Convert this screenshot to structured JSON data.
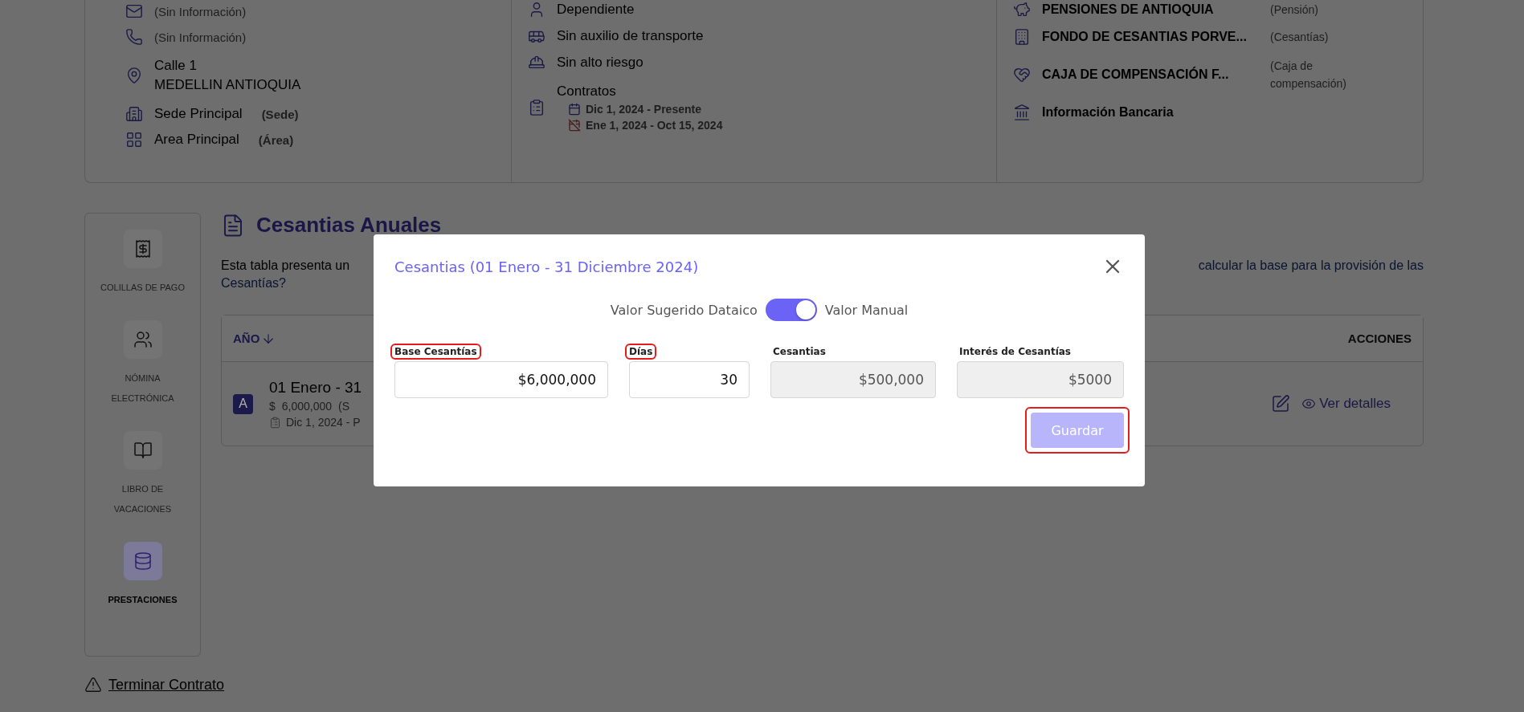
{
  "info_card": {
    "personal": [
      {
        "kind": "missing",
        "text": "(Sin Información)"
      },
      {
        "kind": "missing",
        "text": "(Sin Información)"
      },
      {
        "kind": "address",
        "lines": [
          "Calle 1",
          "MEDELLIN ANTIOQUIA"
        ]
      },
      {
        "kind": "value",
        "text": "Sede Principal",
        "note": "(Sede)"
      },
      {
        "kind": "value",
        "text": "Area Principal",
        "note": "(Área)"
      }
    ],
    "employment": [
      {
        "kind": "value",
        "text": "Dependiente"
      },
      {
        "kind": "value",
        "text": "Sin auxilio de transporte"
      },
      {
        "kind": "value",
        "text": "Sin alto riesgo"
      },
      {
        "kind": "contracts",
        "text": "Contratos",
        "contracts": [
          {
            "period": "Dic 1, 2024 - Presente",
            "active": true
          },
          {
            "period": "Ene 1, 2024 - Oct 15, 2024",
            "active": false
          }
        ]
      }
    ],
    "entities": [
      {
        "name": "PENSIONES DE ANTIOQUIA",
        "role": "(Pensión)"
      },
      {
        "name": "FONDO DE CESANTIAS PORVE...",
        "role": "(Cesantías)"
      },
      {
        "name": "CAJA DE COMPENSACIÓN F...",
        "role": "(Caja de compensación)"
      },
      {
        "name": "Información Bancaria"
      }
    ]
  },
  "sidebar": {
    "items": [
      {
        "label": "COLILLAS DE PAGO",
        "selected": false
      },
      {
        "label": "NÓMINA ELECTRÓNICA",
        "selected": false
      },
      {
        "label": "LIBRO DE VACACIONES",
        "selected": false
      },
      {
        "label": "PRESTACIONES",
        "selected": true
      }
    ]
  },
  "section": {
    "title": "Cesantias Anuales",
    "description_start": "Esta tabla presenta un",
    "description_link": "calcular la base para la provisión de las",
    "description_link_end": "Cesantías?",
    "table": {
      "columns": [
        "AÑO",
        "ACCIONES"
      ],
      "rows": [
        {
          "badge": "A",
          "period": "01 Enero - 31",
          "currency": "$",
          "amount": "6,000,000",
          "amount_note": "(S",
          "contract": "Dic 1, 2024 - P",
          "action": "Ver detalles"
        }
      ]
    }
  },
  "footer": {
    "link": "Terminar Contrato"
  },
  "modal": {
    "title": "Cesantias (01 Enero - 31 Diciembre 2024)",
    "toggle": {
      "left_label": "Valor Sugerido Dataico",
      "right_label": "Valor Manual",
      "on": true
    },
    "fields": [
      {
        "label": "Base Cesantías",
        "value": "$6,000,000",
        "disabled": false,
        "highlighted": true
      },
      {
        "label": "Días",
        "value": "30",
        "disabled": false,
        "highlighted": true
      },
      {
        "label": "Cesantias",
        "value": "$500,000",
        "disabled": true,
        "highlighted": false
      },
      {
        "label": "Interés de Cesantías",
        "value": "$5000",
        "disabled": true,
        "highlighted": false
      }
    ],
    "button": {
      "label": "Guardar",
      "disabled": true,
      "highlighted": true
    }
  }
}
